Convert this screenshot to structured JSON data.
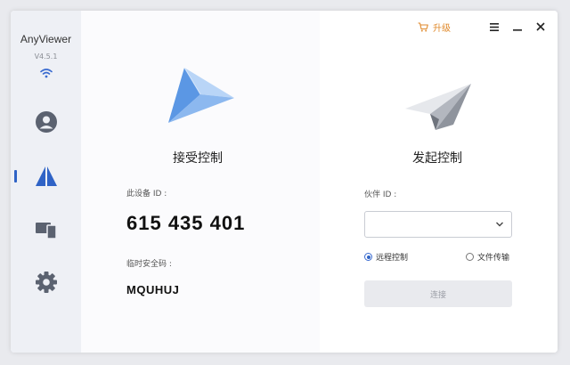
{
  "app": {
    "name": "AnyViewer",
    "version": "V4.5.1"
  },
  "titlebar": {
    "upgrade_label": "升级"
  },
  "receive": {
    "title": "接受控制",
    "device_id_label": "此设备 ID :",
    "device_id": "615 435 401",
    "temp_code_label": "临时安全码 :",
    "temp_code": "MQUHUJ"
  },
  "initiate": {
    "title": "发起控制",
    "partner_id_label": "伙伴 ID :",
    "partner_id_value": "",
    "options": [
      {
        "label": "远程控制",
        "selected": true
      },
      {
        "label": "文件传输",
        "selected": false
      }
    ],
    "connect_label": "连接"
  },
  "colors": {
    "accent": "#2f63c6",
    "upgrade": "#e08a2c",
    "sidebar_bg": "#eef0f5"
  },
  "icons": {
    "sidebar": [
      "account-icon",
      "connection-icon",
      "devices-icon",
      "settings-icon"
    ],
    "titlebar": [
      "cart-icon",
      "menu-icon",
      "minimize-icon",
      "close-icon"
    ]
  }
}
